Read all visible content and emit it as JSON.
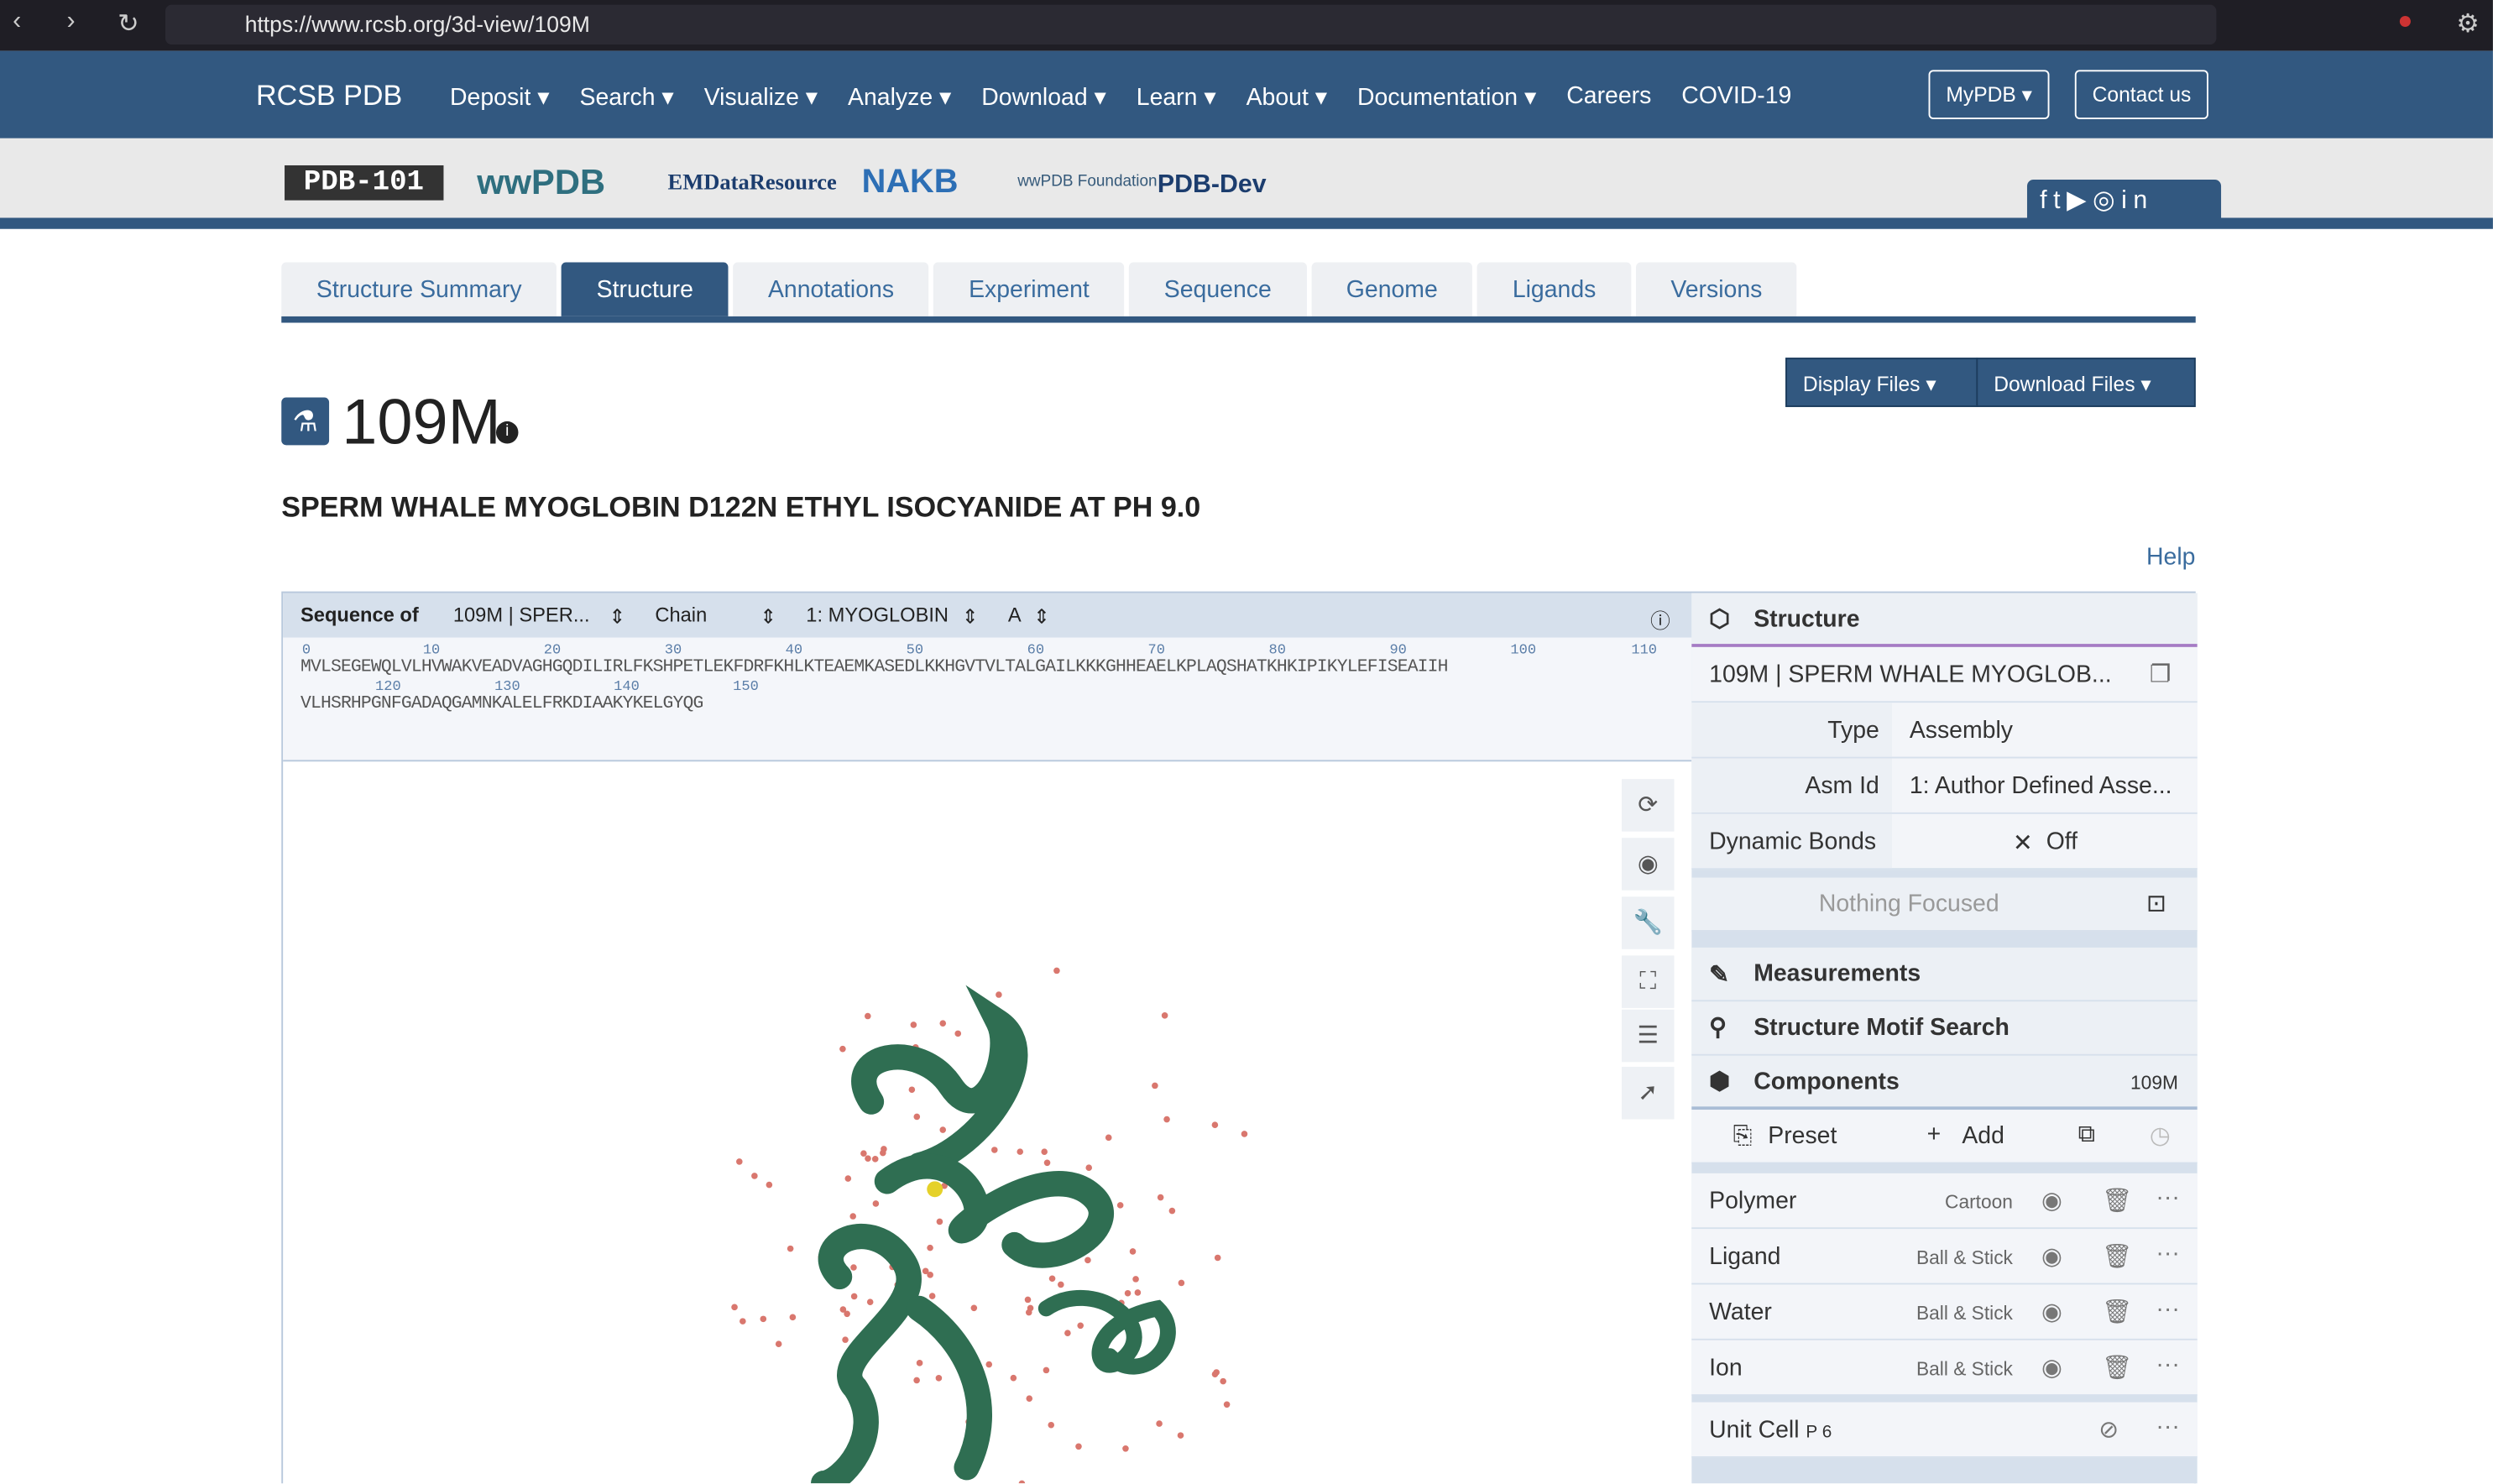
{
  "browser": {
    "url": "https://www.rcsb.org/3d-view/109M"
  },
  "nav": {
    "brand": "RCSB PDB",
    "menu": [
      "Deposit ▾",
      "Search ▾",
      "Visualize ▾",
      "Analyze ▾",
      "Download ▾",
      "Learn ▾",
      "About ▾",
      "Documentation ▾",
      "Careers",
      "COVID-19"
    ],
    "mypdb": "MyPDB ▾",
    "contact": "Contact us"
  },
  "logos": [
    "PDB-101",
    "wwPDB",
    "EMDataResource",
    "NAKB",
    "wwPDB Foundation",
    "PDB-Dev"
  ],
  "tabs": [
    "Structure Summary",
    "Structure",
    "Annotations",
    "Experiment",
    "Sequence",
    "Genome",
    "Ligands",
    "Versions"
  ],
  "files": {
    "display": "Display Files ▾",
    "download": "Download Files ▾"
  },
  "entry": {
    "id": "109M",
    "title": "SPERM WHALE MYOGLOBIN D122N ETHYL ISOCYANIDE AT PH 9.0",
    "help": "Help"
  },
  "sequence": {
    "label": "Sequence of",
    "entity": "109M | SPER...",
    "chain_mode": "Chain",
    "molecule": "1: MYOGLOBIN",
    "chain": "A",
    "line1": "MVLSEGEWQLVLHVWAKVEADVAGHGQDILIRLFKSHPETLEKFDRFKHLKTEAEMKASEDLKKHGVTVLTALGAILKKKGHHEAELKPLAQSHATKHKIPIKYLEFISEAIIH",
    "line2": "VLHSRHPGNFGADAQGAMNKALELFRKDIAAKYKELGYQG",
    "nums1": [
      "0",
      "10",
      "20",
      "30",
      "40",
      "50",
      "60",
      "70",
      "80",
      "90",
      "100",
      "110"
    ],
    "nums2": [
      "120",
      "130",
      "140",
      "150"
    ]
  },
  "panel": {
    "structure": "Structure",
    "selected": "109M | SPERM WHALE MYOGLOB...",
    "type_label": "Type",
    "type_value": "Assembly",
    "asm_label": "Asm Id",
    "asm_value": "1: Author Defined Asse...",
    "bonds_label": "Dynamic Bonds",
    "bonds_value": "Off",
    "focus": "Nothing Focused",
    "measurements": "Measurements",
    "motif": "Structure Motif Search",
    "components": "Components",
    "components_id": "109M",
    "preset": "Preset",
    "add": "Add",
    "items": [
      {
        "name": "Polymer",
        "repr": "Cartoon"
      },
      {
        "name": "Ligand",
        "repr": "Ball & Stick"
      },
      {
        "name": "Water",
        "repr": "Ball & Stick"
      },
      {
        "name": "Ion",
        "repr": "Ball & Stick"
      }
    ],
    "unitcell": "Unit Cell",
    "unitcell_group": "P 6"
  }
}
